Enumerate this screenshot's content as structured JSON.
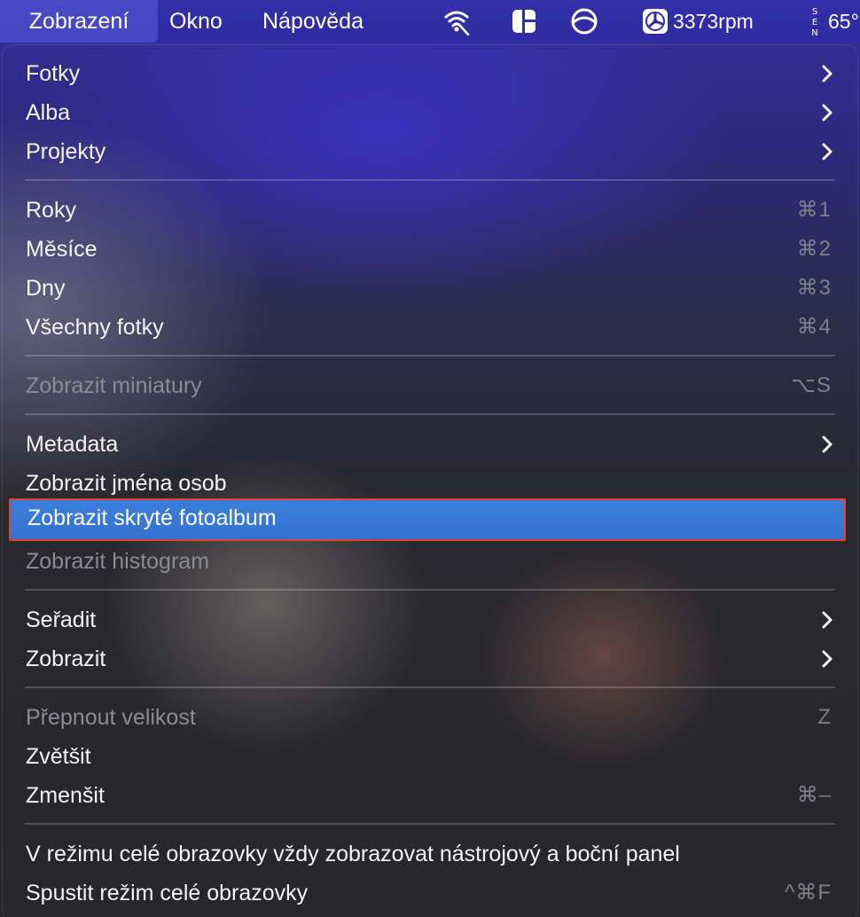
{
  "menubar": {
    "active_menu": "Zobrazení",
    "menus": [
      "Okno",
      "Nápověda"
    ],
    "status": {
      "wifi_icon": "wifi-icon",
      "layout_icon": "window-layout-icon",
      "sync_icon": "circle-icon",
      "fan_speed": "3373rpm",
      "temperature": "65°"
    }
  },
  "menu": {
    "items": [
      {
        "label": "Fotky",
        "submenu": true
      },
      {
        "label": "Alba",
        "submenu": true
      },
      {
        "label": "Projekty",
        "submenu": true
      },
      {
        "label": "Roky",
        "shortcut": "⌘1"
      },
      {
        "label": "Měsíce",
        "shortcut": "⌘2"
      },
      {
        "label": "Dny",
        "shortcut": "⌘3"
      },
      {
        "label": "Všechny fotky",
        "shortcut": "⌘4"
      },
      {
        "label": "Zobrazit miniatury",
        "shortcut": "⌥S",
        "disabled": true
      },
      {
        "label": "Metadata",
        "submenu": true
      },
      {
        "label": "Zobrazit jména osob"
      },
      {
        "label": "Zobrazit skryté fotoalbum",
        "highlighted": true
      },
      {
        "label": "Zobrazit histogram",
        "disabled": true
      },
      {
        "label": "Seřadit",
        "submenu": true
      },
      {
        "label": "Zobrazit",
        "submenu": true
      },
      {
        "label": "Přepnout velikost",
        "shortcut": "Z",
        "disabled": true
      },
      {
        "label": "Zvětšit"
      },
      {
        "label": "Zmenšit",
        "shortcut": "⌘–"
      },
      {
        "label": "V režimu celé obrazovky vždy zobrazovat nástrojový a boční panel"
      },
      {
        "label": "Spustit režim celé obrazovky",
        "shortcut": "^⌘F"
      }
    ]
  },
  "colors": {
    "highlight": "#3c7edb",
    "highlight_outline": "#e14234",
    "menubar": "#322fa8"
  }
}
